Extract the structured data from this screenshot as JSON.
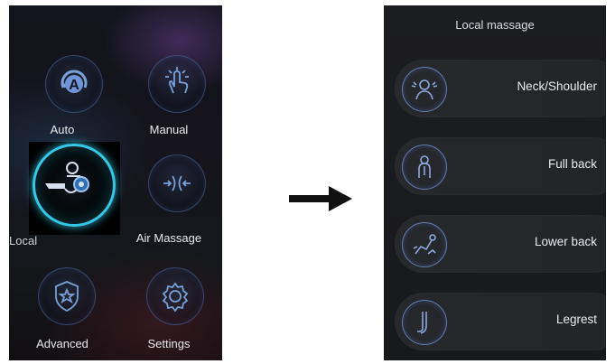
{
  "left_panel": {
    "tiles": [
      {
        "label": "Auto"
      },
      {
        "label": "Manual"
      },
      {
        "label": "Local"
      },
      {
        "label": "Air Massage"
      },
      {
        "label": "Advanced"
      },
      {
        "label": "Settings"
      }
    ],
    "auto_icon_letter": "A"
  },
  "right_panel": {
    "title": "Local massage",
    "items": [
      {
        "label": "Neck/Shoulder",
        "icon": "neck-shoulder-icon"
      },
      {
        "label": "Full back",
        "icon": "full-back-icon"
      },
      {
        "label": "Lower back",
        "icon": "lower-back-icon"
      },
      {
        "label": "Legrest",
        "icon": "legrest-icon"
      }
    ]
  },
  "colors": {
    "highlight_ring": "#36c8e6",
    "icon_stroke": "#6e8cc8"
  }
}
